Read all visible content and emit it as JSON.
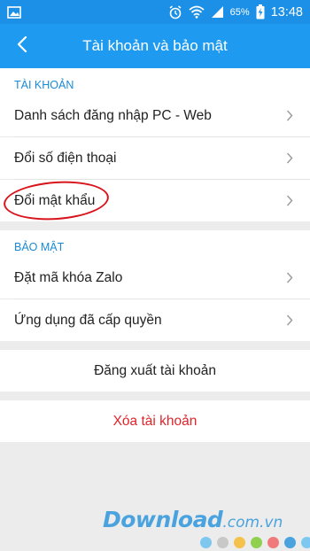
{
  "status_bar": {
    "battery_percent": "65%",
    "time": "13:48",
    "icons": [
      "image-icon",
      "alarm-icon",
      "wifi-icon",
      "signal-icon",
      "battery-charging-icon"
    ]
  },
  "header": {
    "title": "Tài khoản và bảo mật",
    "back_icon": "back-chevron-icon"
  },
  "account_section": {
    "heading": "TÀI KHOẢN",
    "items": [
      {
        "label": "Danh sách đăng nhập PC - Web"
      },
      {
        "label": "Đổi số điện thoại"
      },
      {
        "label": "Đổi mật khẩu"
      }
    ]
  },
  "security_section": {
    "heading": "BẢO MẬT",
    "items": [
      {
        "label": "Đặt mã khóa Zalo"
      },
      {
        "label": "Ứng dụng đã cấp quyền"
      }
    ]
  },
  "actions": {
    "logout_label": "Đăng xuất tài khoản",
    "delete_label": "Xóa tài khoản"
  },
  "watermark": {
    "brand": "Download",
    "suffix": ".com.vn",
    "dot_colors": [
      "#7ec8ef",
      "#c8c8c8",
      "#f4c14a",
      "#8fd14f",
      "#f07a7a",
      "#4aa3de",
      "#7ec8ef"
    ]
  },
  "colors": {
    "accent": "#1e9bf0",
    "section_heading": "#1a8ad6",
    "danger": "#e0242a",
    "annotation": "#d9141c"
  }
}
